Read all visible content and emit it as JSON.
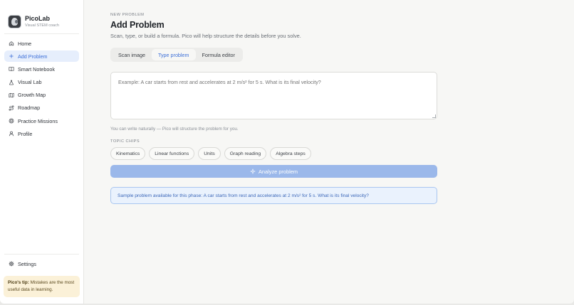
{
  "brand": {
    "name": "PicoLab",
    "tagline": "Visual STEM coach"
  },
  "sidebar": {
    "items": [
      {
        "label": "Home",
        "icon": "home-icon",
        "active": false
      },
      {
        "label": "Add Problem",
        "icon": "plus-icon",
        "active": true
      },
      {
        "label": "Smart Notebook",
        "icon": "book-icon",
        "active": false
      },
      {
        "label": "Visual Lab",
        "icon": "flask-icon",
        "active": false
      },
      {
        "label": "Growth Map",
        "icon": "map-icon",
        "active": false
      },
      {
        "label": "Roadmap",
        "icon": "route-icon",
        "active": false
      },
      {
        "label": "Practice Missions",
        "icon": "target-icon",
        "active": false
      },
      {
        "label": "Profile",
        "icon": "user-icon",
        "active": false
      }
    ],
    "settings_label": "Settings",
    "tip": {
      "title": "Pico's tip:",
      "text": "Mistakes are the most useful data in learning."
    }
  },
  "main": {
    "eyebrow": "NEW PROBLEM",
    "title": "Add Problem",
    "subtitle": "Scan, type, or build a formula. Pico will help structure the details before you solve.",
    "tabs": [
      {
        "label": "Scan image",
        "active": false
      },
      {
        "label": "Type problem",
        "active": true
      },
      {
        "label": "Formula editor",
        "active": false
      }
    ],
    "problem_placeholder": "Example: A car starts from rest and accelerates at 2 m/s² for 5 s. What is its final velocity?",
    "helper_text": "You can write naturally — Pico will structure the problem for you.",
    "chips_label": "TOPIC CHIPS",
    "chips": [
      "Kinematics",
      "Linear functions",
      "Units",
      "Graph reading",
      "Algebra steps"
    ],
    "analyze_label": "Analyze problem",
    "sample_text": "Sample problem available for this phase: A car starts from rest and accelerates at 2 m/s² for 5 s. What is its final velocity?"
  },
  "colors": {
    "accent": "#3c6fd8",
    "active_bg": "#e6eefc",
    "button_disabled": "#9bb8ea",
    "tip_bg": "#fbf1d8"
  }
}
